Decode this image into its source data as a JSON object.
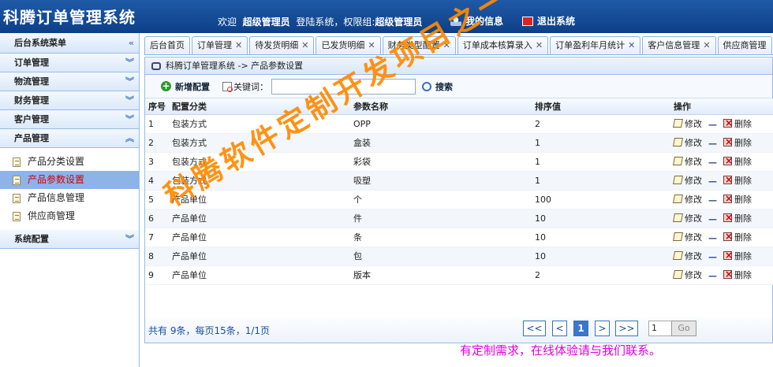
{
  "app": {
    "title": "科腾订单管理系统",
    "welcome_prefix": "欢迎",
    "user": "超级管理员",
    "login_text": "登陆系统，权限组:",
    "role": "超级管理员",
    "my_info": "我的信息",
    "logout": "退出系统"
  },
  "sidebar": {
    "header": "后台系统菜单",
    "sections": [
      {
        "label": "订单管理"
      },
      {
        "label": "物流管理"
      },
      {
        "label": "财务管理"
      },
      {
        "label": "客户管理"
      },
      {
        "label": "产品管理"
      }
    ],
    "product_items": [
      {
        "label": "产品分类设置"
      },
      {
        "label": "产品参数设置"
      },
      {
        "label": "产品信息管理"
      },
      {
        "label": "供应商管理"
      }
    ],
    "system_section": "系统配置"
  },
  "tabs": [
    "后台首页",
    "订单管理",
    "待发货明细",
    "已发货明细",
    "财务类型配置",
    "订单成本核算录入",
    "订单盈利年月统计",
    "客户信息管理",
    "供应商管理"
  ],
  "breadcrumb": "科腾订单管理系统 -> 产品参数设置",
  "toolbar": {
    "add": "新增配置",
    "keyword_label": "关键词：",
    "keyword_value": "",
    "search": "搜索"
  },
  "table": {
    "headers": [
      "序号",
      "配置分类",
      "参数名称",
      "排序值",
      "操作"
    ],
    "rows": [
      {
        "no": "1",
        "cat": "包装方式",
        "name": "OPP",
        "sort": "2"
      },
      {
        "no": "2",
        "cat": "包装方式",
        "name": "盒装",
        "sort": "1"
      },
      {
        "no": "3",
        "cat": "包装方式",
        "name": "彩袋",
        "sort": "1"
      },
      {
        "no": "4",
        "cat": "包装方式",
        "name": "吸塑",
        "sort": "1"
      },
      {
        "no": "5",
        "cat": "产品单位",
        "name": "个",
        "sort": "100"
      },
      {
        "no": "6",
        "cat": "产品单位",
        "name": "件",
        "sort": "10"
      },
      {
        "no": "7",
        "cat": "产品单位",
        "name": "条",
        "sort": "10"
      },
      {
        "no": "8",
        "cat": "产品单位",
        "name": "包",
        "sort": "10"
      },
      {
        "no": "9",
        "cat": "产品单位",
        "name": "版本",
        "sort": "2"
      }
    ],
    "edit_label": "修改",
    "delete_label": "删除"
  },
  "pager": {
    "info": "共有 9条，每页15条，1/1页",
    "first": "<<",
    "prev": "<",
    "current": "1",
    "next": ">",
    "last": ">>",
    "goto_value": "1",
    "go": "Go"
  },
  "watermark": "科腾软件定制开发项目之一",
  "footer_note": "有定制需求，在线体验请与我们联系。"
}
